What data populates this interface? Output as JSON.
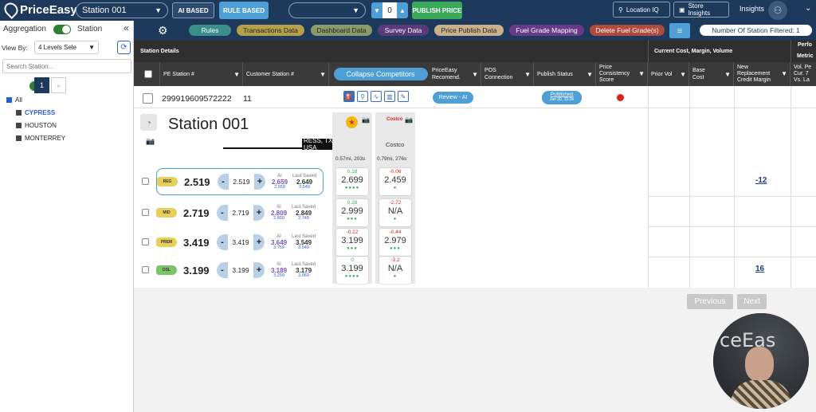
{
  "topbar": {
    "logo": "PriceEasy",
    "tm": "™",
    "station_select": "Station 001",
    "ai_based": "AI BASED",
    "rule_based": "RULE BASED",
    "secondary_select": "",
    "counter": "0",
    "publish": "PUBLISH PRICE",
    "location_iq": "Location IQ",
    "store_insights": "Store Insights",
    "insights": "Insights"
  },
  "sidebar": {
    "aggregation": "Aggregation",
    "station": "Station",
    "view_by_label": "View By:",
    "view_by_value": "4 Levels Sele",
    "search_placeholder": "Search Station...",
    "page": "1",
    "page_next": "»",
    "tree": [
      "All",
      "CYPRESS",
      "HOUSTON",
      "MONTERREY"
    ]
  },
  "tabs": {
    "rules": "Rules",
    "transactions": "Transactions Data",
    "dashboard": "Dashboard Data",
    "survey": "Survey Data",
    "price_publish": "Price Publish Data",
    "fuel_grade": "Fuel Grade Mapping",
    "delete_fuel": "Delete Fuel Grade(s)",
    "filtered": "Number Of Station Filtered: 1"
  },
  "colors": {
    "navy": "#1d3a5c",
    "rules": "#3a8f8a",
    "transactions": "#b5a14a",
    "dashboard": "#8a9a6a",
    "survey": "#5a3a7a",
    "price_publish": "#c9b08a",
    "fuel_grade": "#6a3a8a",
    "delete_fuel": "#b04a3a",
    "publish": "#3aaa5a"
  },
  "table": {
    "station_details": "Station Details",
    "current_cost": "Current Cost, Margin, Volume",
    "perf": "Perfo",
    "metrics": "Metric",
    "columns": {
      "pe_station": "PE Station #",
      "customer_station": "Customer Station #",
      "collapse": "Collapse Competitors",
      "priceeasy_rec": "PriceEasy Recomend.",
      "pos_connection": "POS Connection",
      "publish_status": "Publish Status",
      "price_consistency": "Price Consistency Score",
      "prior_vol": "Prior Vol",
      "base_cost": "Base Cost",
      "new_replacement": "New Replacement Credit Margin",
      "vol_pe": "Vol. Pe Cur. 7 Vs. La"
    },
    "row": {
      "pe_station": "299919609572222",
      "customer_station": "11",
      "recommend": "Review - AI",
      "published": "Published",
      "published_date": "Jan 30, 15:36"
    }
  },
  "station_block": {
    "name": "Station 001",
    "address": "RESS, TX 77429, USA",
    "costco": "Costco",
    "costco_logo": "Costco",
    "dist1": "0.57mi, 203s",
    "dist2": "0.79mi, 276s"
  },
  "grades": [
    {
      "code": "REG",
      "price": "2.519",
      "step": "2.519",
      "ai_label": "AI",
      "ls_label": "Last Saved",
      "ai": "2.659",
      "last": "2.649",
      "ai_sub": "2.659",
      "last_sub": "2.549",
      "c1_diff": "0.18",
      "c1_price": "2.699",
      "c1_dots": "●●●●",
      "c2_diff": "-0.06",
      "c2_price": "2.459",
      "c2_dots": "●",
      "margin": "-12",
      "color": "#e6cf5a"
    },
    {
      "code": "MID",
      "price": "2.719",
      "step": "2.719",
      "ai_label": "AI",
      "ls_label": "Last Saved",
      "ai": "2.809",
      "last": "2.849",
      "ai_sub": "2.809",
      "last_sub": "2.749",
      "c1_diff": "0.28",
      "c1_price": "2.999",
      "c1_dots": "●●●",
      "c2_diff": "-2.72",
      "c2_price": "N/A",
      "c2_dots": "●",
      "margin": "",
      "color": "#e6cf5a"
    },
    {
      "code": "PREM",
      "price": "3.419",
      "step": "3.419",
      "ai_label": "AI",
      "ls_label": "Last Saved",
      "ai": "3.649",
      "last": "3.549",
      "ai_sub": "3.759",
      "last_sub": "3.549",
      "c1_diff": "-0.22",
      "c1_price": "3.199",
      "c1_dots": "●●●",
      "c2_diff": "-0.44",
      "c2_price": "2.979",
      "c2_dots": "●●●",
      "margin": "",
      "color": "#e6cf5a"
    },
    {
      "code": "DSL",
      "price": "3.199",
      "step": "3.199",
      "ai_label": "AI",
      "ls_label": "Last Saved",
      "ai": "3.189",
      "last": "3.179",
      "ai_sub": "3.299",
      "last_sub": "3.069",
      "c1_diff": "0",
      "c1_price": "3.199",
      "c1_dots": "●●●●",
      "c2_diff": "-3.2",
      "c2_price": "N/A",
      "c2_dots": "●",
      "margin": "16",
      "color": "#7cc46a"
    }
  ],
  "pagination": {
    "previous": "Previous",
    "next": "Next"
  },
  "webcam": {
    "overlay": "ceEas"
  }
}
